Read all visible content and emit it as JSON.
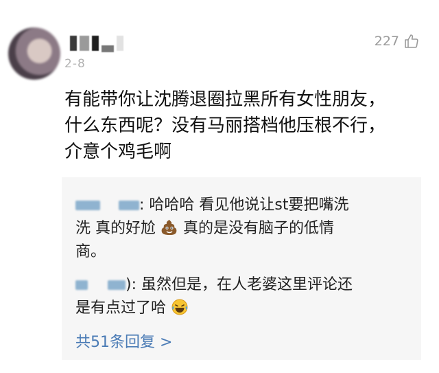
{
  "comment": {
    "date": "2-8",
    "like_count": "227",
    "icons": {
      "like": "thumbs-up-icon",
      "avatar": "blurred-avatar"
    },
    "lines": [
      "有能带你让沈腾退圈拉黑所有女性朋友，",
      "什么东西呢？没有马丽搭档他压根不行，",
      "介意个鸡毛啊"
    ]
  },
  "replies": {
    "items": [
      {
        "lines": [
          ": 哈哈哈 看见他说让st要把嘴洗",
          "洗 真的好尬",
          "真的是没有脑子的低情",
          "商。"
        ],
        "emoji": "poop-emoji"
      },
      {
        "lines": [
          "): 虽然但是，在人老婆这里评论还",
          "是有点过了哈"
        ],
        "emoji": "laughing-tears-emoji"
      }
    ],
    "more_label": "共51条回复 >"
  },
  "colors": {
    "link": "#4a7bb5",
    "muted": "#9a9a9a",
    "reply_bg": "#f6f6f6"
  }
}
